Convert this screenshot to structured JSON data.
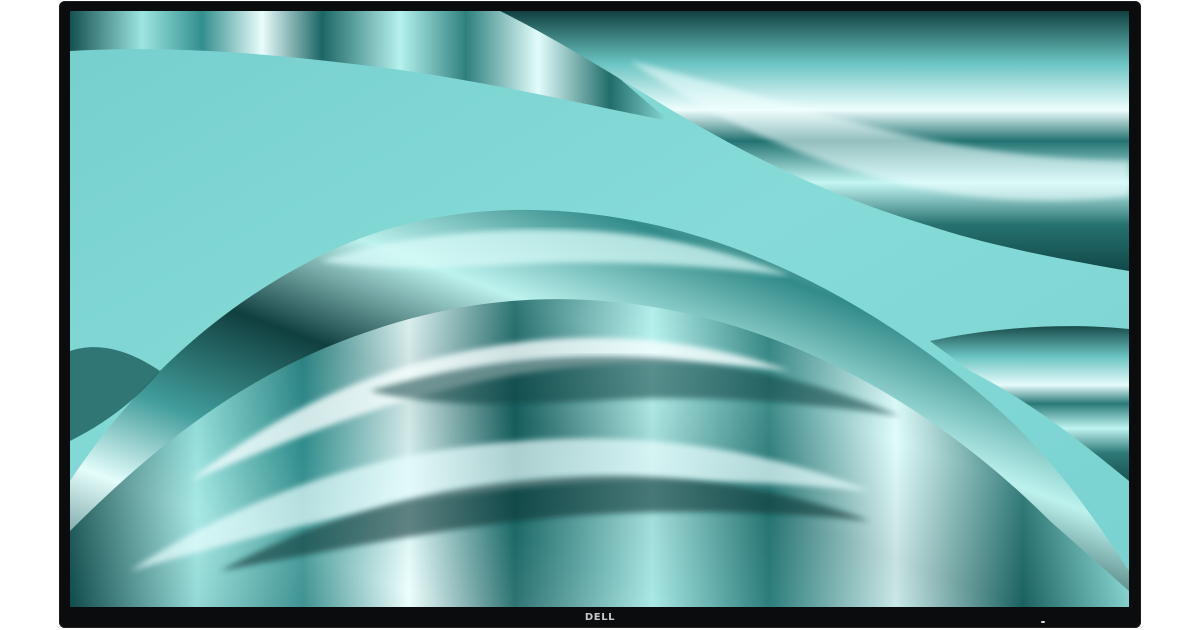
{
  "product": {
    "brand_logo_text": "DELL"
  },
  "wallpaper": {
    "description_icon": "abstract-ribbon-wallpaper",
    "colors": {
      "base": "#7fd6d4",
      "light": "#bff2ef",
      "mid": "#4aa7a6",
      "dark": "#0e3f3f",
      "highlight": "#f2ffff"
    }
  },
  "bezel": {
    "color": "#0b0c0d",
    "logo_color": "#c8c9cb"
  }
}
